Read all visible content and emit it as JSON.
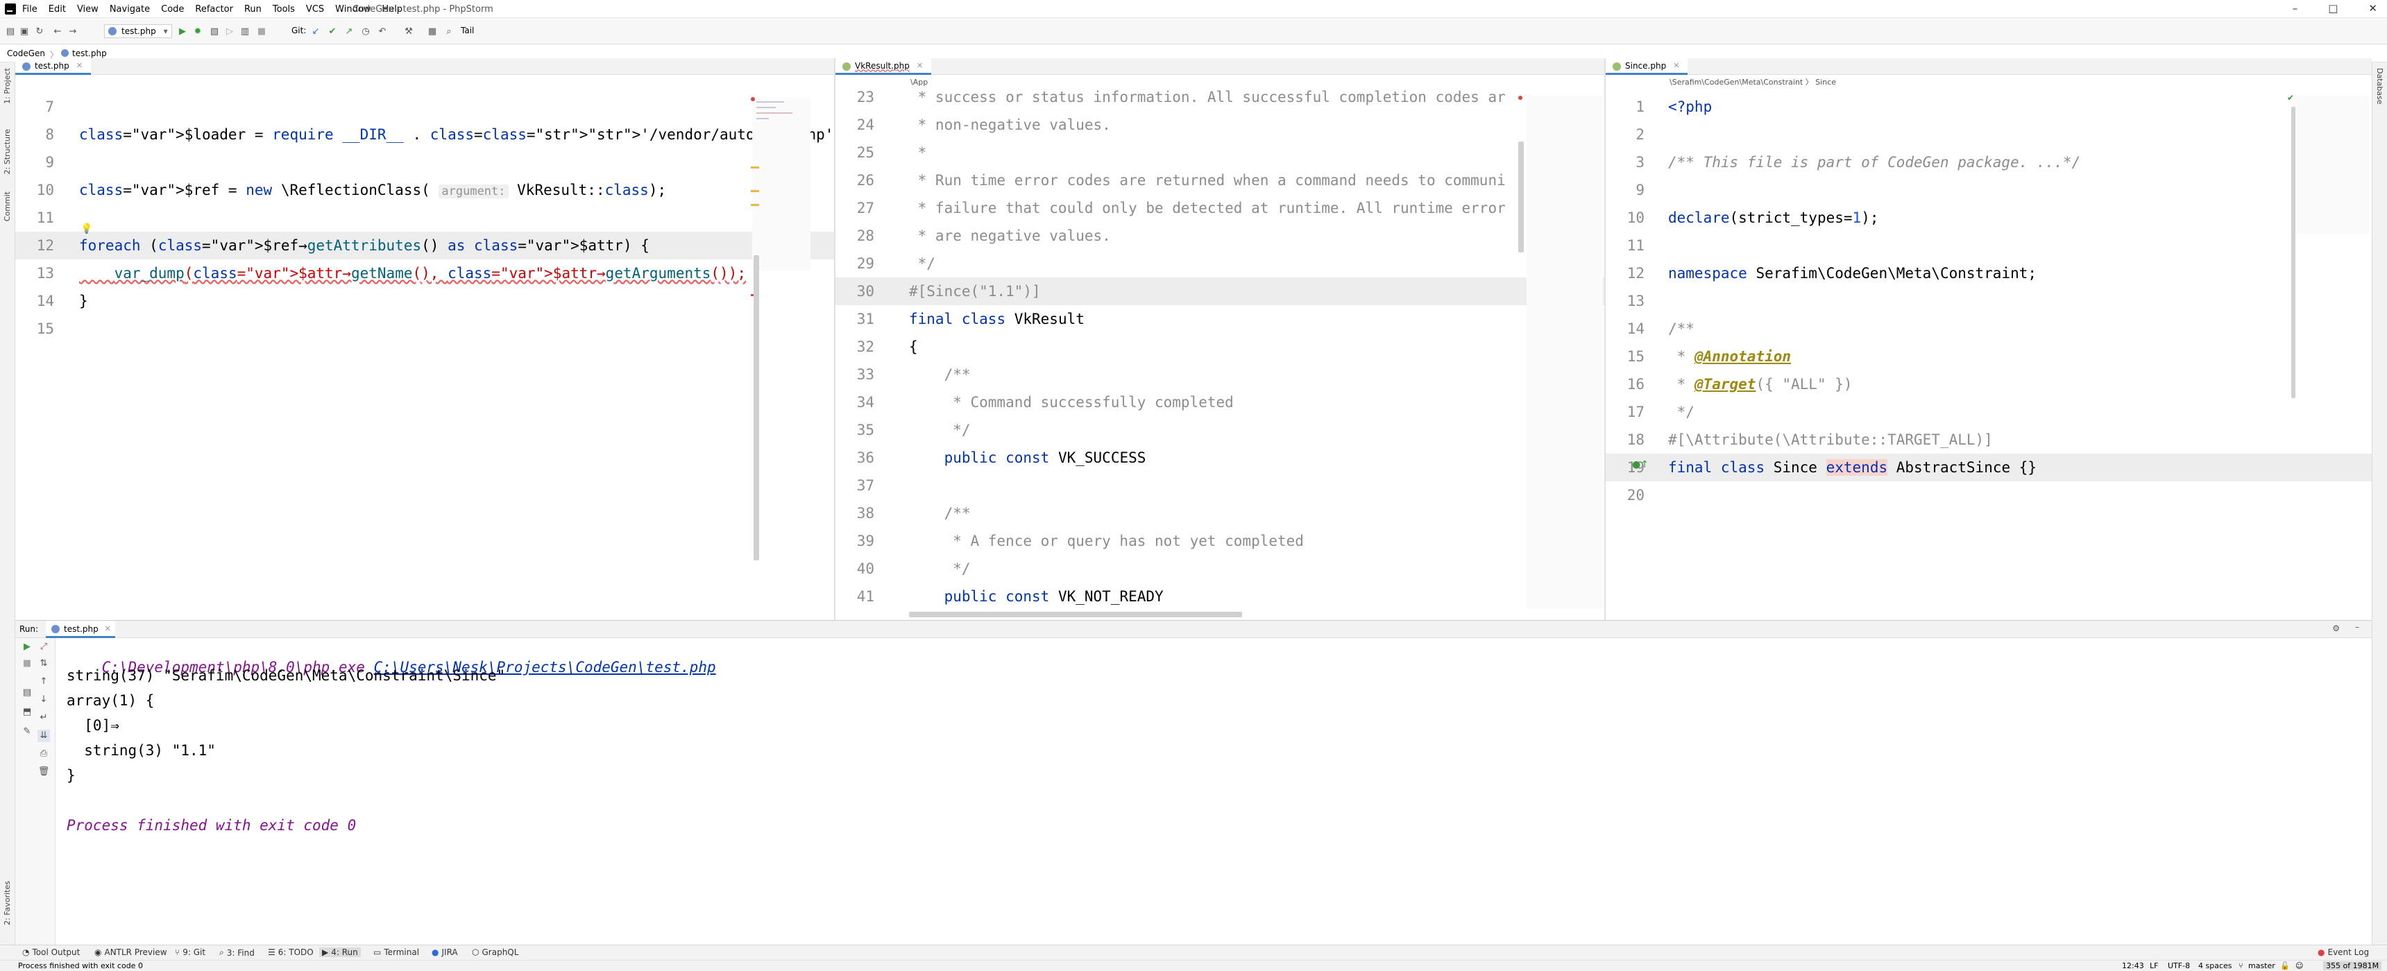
{
  "window": {
    "title": "CodeGen - test.php - PhpStorm",
    "controls": [
      "–",
      "□",
      "✕"
    ]
  },
  "menu": [
    "File",
    "Edit",
    "View",
    "Navigate",
    "Code",
    "Refactor",
    "Run",
    "Tools",
    "VCS",
    "Window",
    "Help"
  ],
  "toolbar": {
    "run_config": "test.php",
    "git_label": "Git:",
    "tail_label": "Tail"
  },
  "nav": {
    "project": "CodeGen",
    "file": "test.php"
  },
  "left_strip": [
    "1: Project",
    "2: Structure",
    "Commit",
    "2: Favorites"
  ],
  "right_strip": [
    "Database"
  ],
  "panes": {
    "left": {
      "tab": "test.php",
      "lines": [
        {
          "n": "7",
          "code": ""
        },
        {
          "n": "8",
          "code": "$loader = require __DIR__ . '/vendor/autoload.php';"
        },
        {
          "n": "9",
          "code": ""
        },
        {
          "n": "10",
          "code": "$ref = new \\ReflectionClass( argument: VkResult::class);"
        },
        {
          "n": "11",
          "code": ""
        },
        {
          "n": "12",
          "code": "foreach ($ref→getAttributes() as $attr) {"
        },
        {
          "n": "13",
          "code": "    var_dump($attr→getName(), $attr→getArguments());"
        },
        {
          "n": "14",
          "code": "}"
        },
        {
          "n": "15",
          "code": ""
        }
      ]
    },
    "middle": {
      "tab": "VkResult.php",
      "breadcrumb": "\\App",
      "lines": [
        {
          "n": "23",
          "code": " * success or status information. All successful completion codes ar"
        },
        {
          "n": "24",
          "code": " * non-negative values."
        },
        {
          "n": "25",
          "code": " *"
        },
        {
          "n": "26",
          "code": " * Run time error codes are returned when a command needs to communi"
        },
        {
          "n": "27",
          "code": " * failure that could only be detected at runtime. All runtime error"
        },
        {
          "n": "28",
          "code": " * are negative values."
        },
        {
          "n": "29",
          "code": " */"
        },
        {
          "n": "30",
          "code": "#[Since(\"1.1\")]"
        },
        {
          "n": "31",
          "code": "final class VkResult"
        },
        {
          "n": "32",
          "code": "{"
        },
        {
          "n": "33",
          "code": "    /**"
        },
        {
          "n": "34",
          "code": "     * Command successfully completed"
        },
        {
          "n": "35",
          "code": "     */"
        },
        {
          "n": "36",
          "code": "    public const VK_SUCCESS"
        },
        {
          "n": "37",
          "code": ""
        },
        {
          "n": "38",
          "code": "    /**"
        },
        {
          "n": "39",
          "code": "     * A fence or query has not yet completed"
        },
        {
          "n": "40",
          "code": "     */"
        },
        {
          "n": "41",
          "code": "    public const VK_NOT_READY"
        }
      ]
    },
    "right": {
      "tab": "Since.php",
      "breadcrumb": "\\Serafim\\CodeGen\\Meta\\Constraint  〉 Since",
      "lines": [
        {
          "n": "1",
          "code": "<?php"
        },
        {
          "n": "2",
          "code": ""
        },
        {
          "n": "3",
          "code": "/** This file is part of CodeGen package. ...*/"
        },
        {
          "n": "9",
          "code": ""
        },
        {
          "n": "10",
          "code": "declare(strict_types=1);"
        },
        {
          "n": "11",
          "code": ""
        },
        {
          "n": "12",
          "code": "namespace Serafim\\CodeGen\\Meta\\Constraint;"
        },
        {
          "n": "13",
          "code": ""
        },
        {
          "n": "14",
          "code": "/**"
        },
        {
          "n": "15",
          "code": " * @Annotation"
        },
        {
          "n": "16",
          "code": " * @Target({ \"ALL\" })"
        },
        {
          "n": "17",
          "code": " */"
        },
        {
          "n": "18",
          "code": "#[\\Attribute(\\Attribute::TARGET_ALL)]"
        },
        {
          "n": "19",
          "code": "final class Since extends AbstractSince {}"
        },
        {
          "n": "20",
          "code": ""
        }
      ]
    }
  },
  "run": {
    "label": "Run:",
    "tab": "test.php",
    "console": {
      "cmd_exe": "C:\\Development\\php\\8.0\\php.exe",
      "cmd_file": "C:\\Users\\Nesk\\Projects\\CodeGen\\test.php",
      "out1": "string(37) \"Serafim\\CodeGen\\Meta\\Constraint\\Since\"",
      "out2": "array(1) {",
      "out3": "  [0]⇒",
      "out4": "  string(3) \"1.1\"",
      "out5": "}",
      "finish": "Process finished with exit code 0"
    }
  },
  "tool_windows": [
    "Tool Output",
    "ANTLR Preview",
    "9: Git",
    "3: Find",
    "6: TODO",
    "4: Run",
    "Terminal",
    "JIRA",
    "GraphQL"
  ],
  "event_log": "Event Log",
  "status": {
    "message": "Process finished with exit code 0",
    "position": "12:43",
    "line_sep": "LF",
    "encoding": "UTF-8",
    "indent": "4 spaces",
    "branch": "master",
    "memory": "355 of 1981M"
  }
}
